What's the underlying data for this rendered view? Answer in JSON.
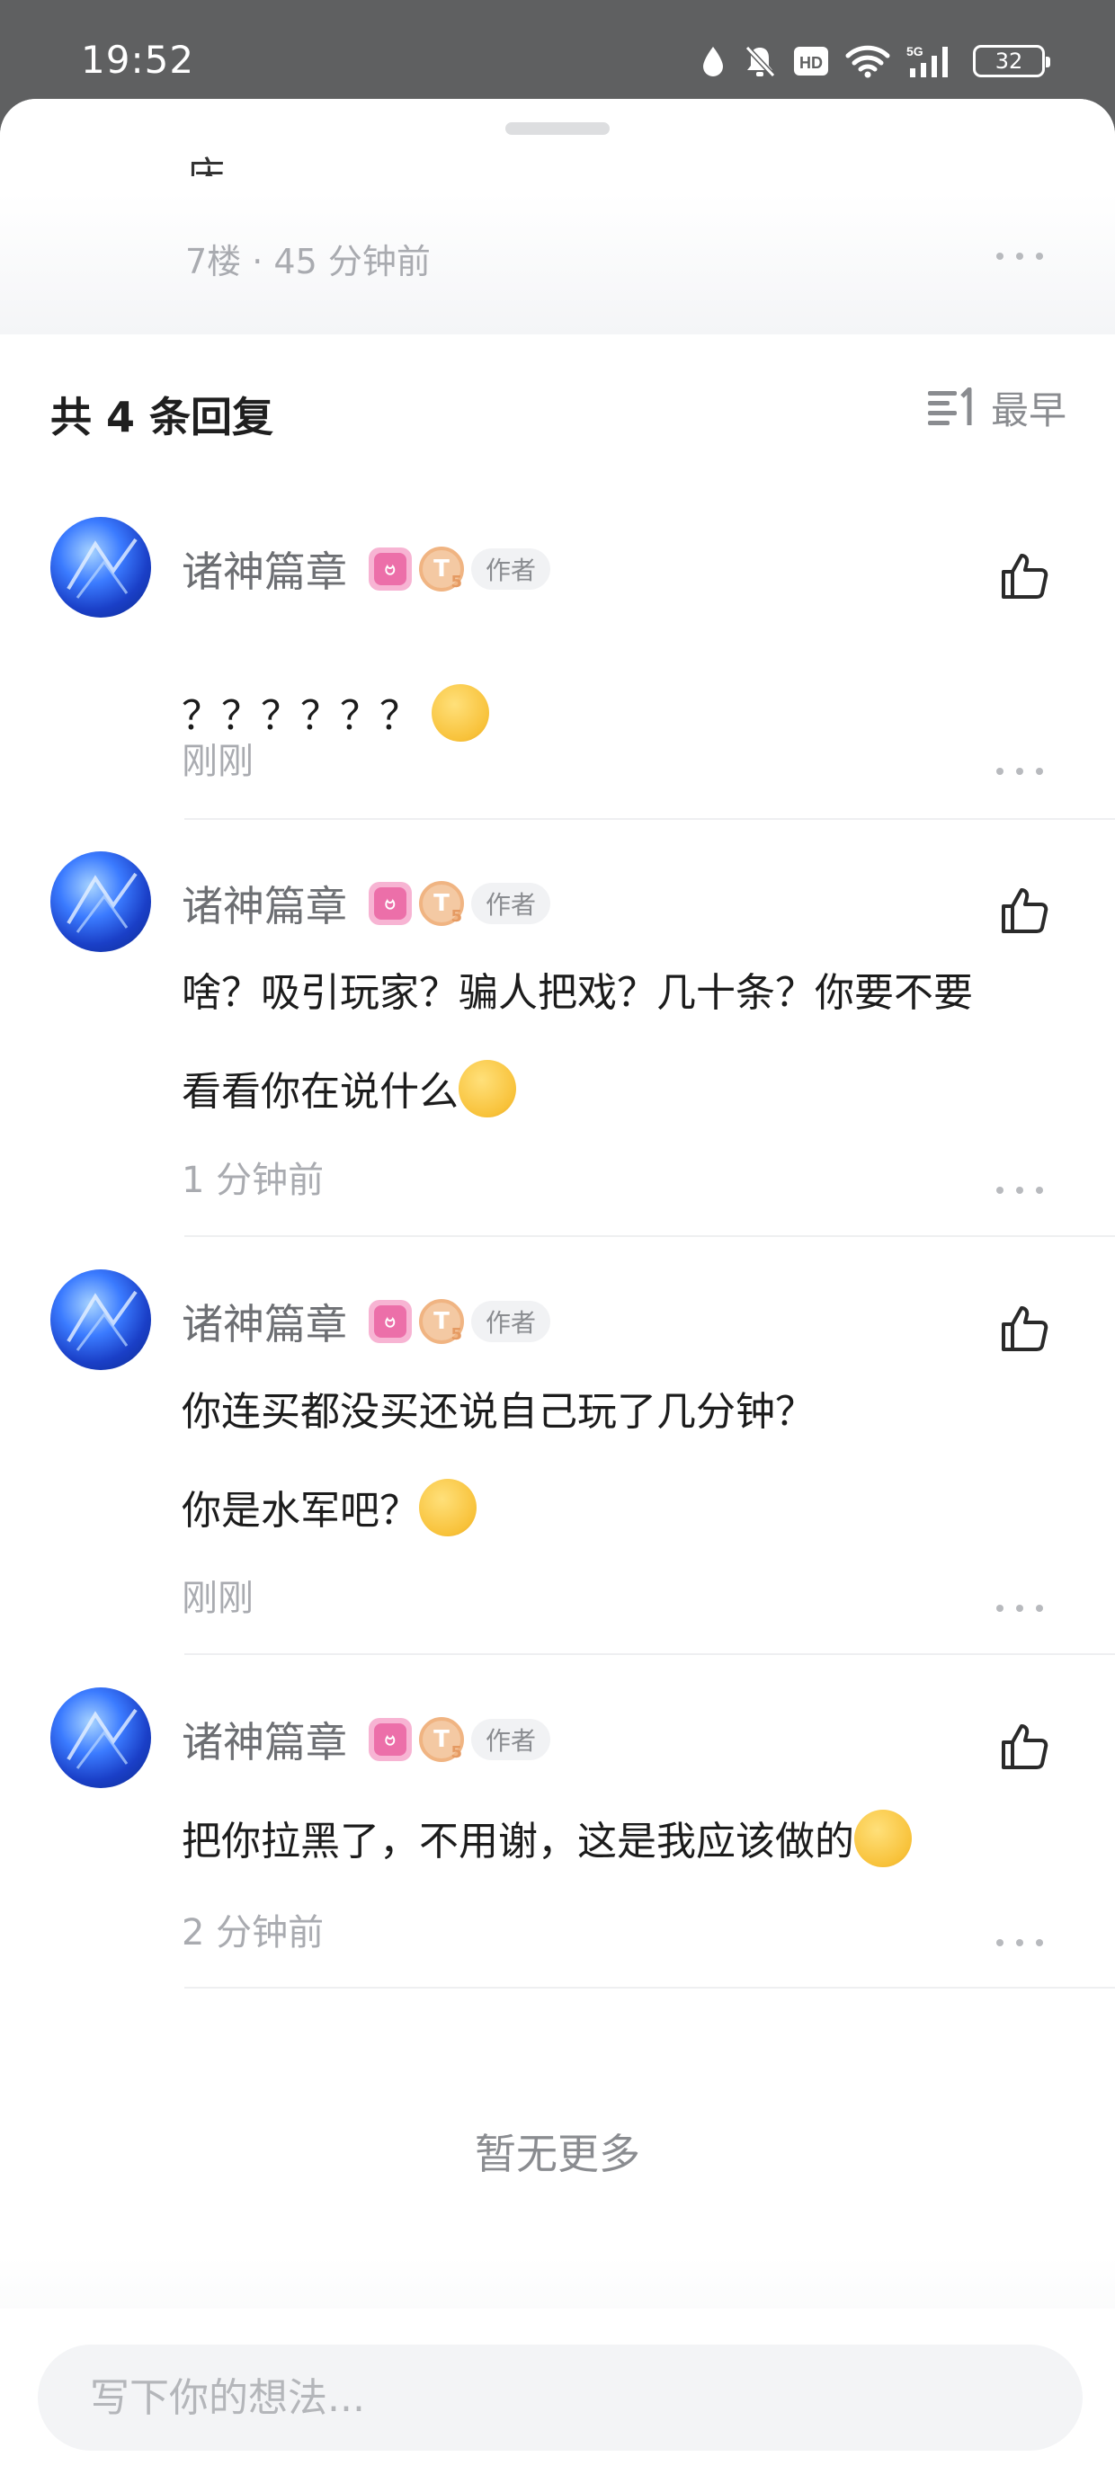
{
  "status_bar": {
    "time": "19:52",
    "battery": "32",
    "icons": [
      "water-drop-icon",
      "mute-bell-icon",
      "hd-icon",
      "wifi-icon",
      "5g-signal-icon",
      "battery-icon"
    ]
  },
  "parent_comment": {
    "text_fragment": "床",
    "meta": "7楼 · 45 分钟前"
  },
  "replies_header": {
    "count_label": "共 4 条回复",
    "sort_label": "最早",
    "sort_icon": "sort-lines-icon"
  },
  "replies": [
    {
      "username": "诸神篇章",
      "author_badge": "作者",
      "line1": "？？？？？？",
      "line2": "",
      "emoji": "squinting-face-emoji",
      "time": "刚刚"
    },
    {
      "username": "诸神篇章",
      "author_badge": "作者",
      "line1": "啥？吸引玩家？骗人把戏？几十条？你要不要",
      "line2": "看看你在说什么",
      "emoji": "grumbling-face-emoji",
      "time": "1 分钟前"
    },
    {
      "username": "诸神篇章",
      "author_badge": "作者",
      "line1": "你连买都没买还说自己玩了几分钟？",
      "line2": "你是水军吧？",
      "emoji": "sunglasses-sweat-emoji",
      "time": "刚刚"
    },
    {
      "username": "诸神篇章",
      "author_badge": "作者",
      "line1": "把你拉黑了，不用谢，这是我应该做的",
      "line2": "",
      "emoji": "rose-face-emoji",
      "time": "2 分钟前"
    }
  ],
  "no_more_label": "暂无更多",
  "input": {
    "placeholder": "写下你的想法...",
    "value": ""
  },
  "colors": {
    "status_bar_bg": "#5f6061",
    "primary_text": "#1c1c1c",
    "secondary_text": "#a9abb0",
    "username": "#6d6f73",
    "badge_pink": "#ec6fa9",
    "badge_gold": "#f0b482"
  }
}
